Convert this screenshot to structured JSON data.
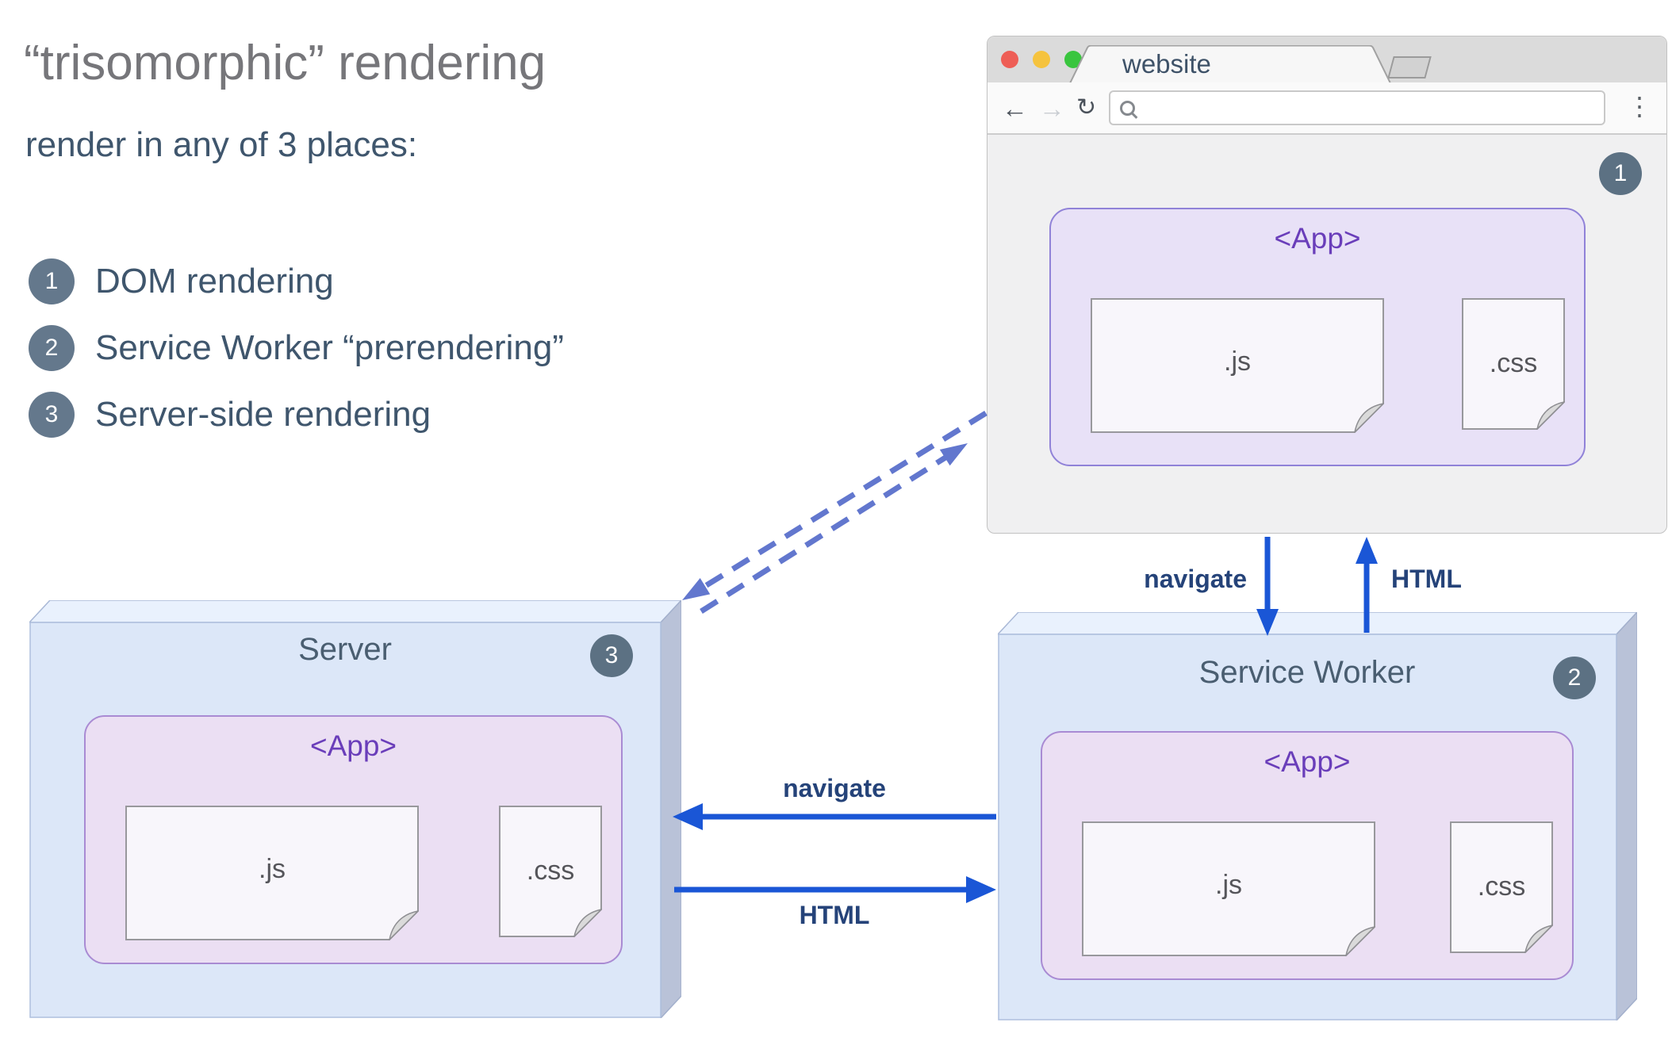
{
  "page": {
    "title": "“trisomorphic” rendering",
    "subtitle": "render in any of 3 places:",
    "legend": [
      {
        "num": "1",
        "label": "DOM rendering"
      },
      {
        "num": "2",
        "label": "Service Worker “prerendering”"
      },
      {
        "num": "3",
        "label": "Server-side rendering"
      }
    ]
  },
  "browser": {
    "tab_title": "website",
    "url_value": "",
    "badge": "1",
    "toolbar": {
      "back": "←",
      "forward": "→",
      "reload": "↻",
      "menu": "⋮"
    },
    "app": {
      "label": "<App>",
      "files": [
        {
          "name": ".js"
        },
        {
          "name": ".css"
        }
      ]
    }
  },
  "server": {
    "title": "Server",
    "badge": "3",
    "app": {
      "label": "<App>",
      "files": [
        {
          "name": ".js"
        },
        {
          "name": ".css"
        }
      ]
    }
  },
  "service_worker": {
    "title": "Service Worker",
    "badge": "2",
    "app": {
      "label": "<App>",
      "files": [
        {
          "name": ".js"
        },
        {
          "name": ".css"
        }
      ]
    }
  },
  "arrows": {
    "browser_sw_down": "navigate",
    "sw_browser_up": "HTML",
    "sw_server_left": "navigate",
    "server_sw_right": "HTML"
  },
  "colors": {
    "accent_blue": "#1a56d6",
    "dashed_blue": "#6277ce",
    "badge_slate": "#5c7183",
    "panel_purple": "#ebdff3",
    "purple_text": "#6a3eba",
    "box_face": "#dce7f8",
    "traffic_red": "#ee5e56",
    "traffic_yellow": "#f5c33e",
    "traffic_green": "#39c53e"
  }
}
